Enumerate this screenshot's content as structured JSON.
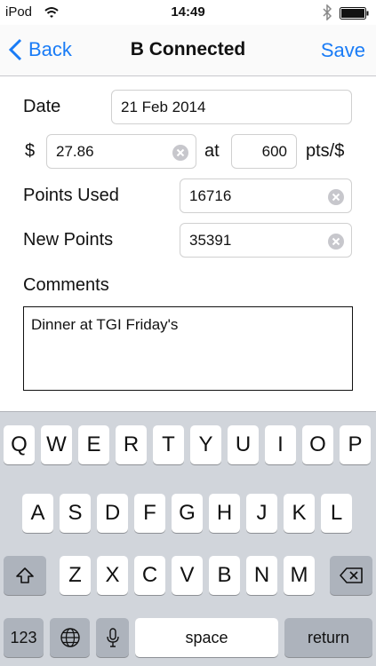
{
  "status_bar": {
    "carrier": "iPod",
    "time": "14:49"
  },
  "nav": {
    "back_label": "Back",
    "title": "B Connected",
    "save_label": "Save"
  },
  "form": {
    "date_label": "Date",
    "date_value": "21 Feb 2014",
    "currency_symbol": "$",
    "amount_value": "27.86",
    "at_label": "at",
    "rate_value": "600",
    "rate_unit": "pts/$",
    "points_used_label": "Points Used",
    "points_used_value": "16716",
    "new_points_label": "New Points",
    "new_points_value": "35391",
    "comments_label": "Comments",
    "comments_value": "Dinner at TGI Friday's"
  },
  "keyboard": {
    "row1": [
      "Q",
      "W",
      "E",
      "R",
      "T",
      "Y",
      "U",
      "I",
      "O",
      "P"
    ],
    "row2": [
      "A",
      "S",
      "D",
      "F",
      "G",
      "H",
      "J",
      "K",
      "L"
    ],
    "row3": [
      "Z",
      "X",
      "C",
      "V",
      "B",
      "N",
      "M"
    ],
    "numbers_label": "123",
    "space_label": "space",
    "return_label": "return"
  },
  "colors": {
    "accent": "#1a7cf6",
    "keyboard_bg": "#d1d5db"
  }
}
